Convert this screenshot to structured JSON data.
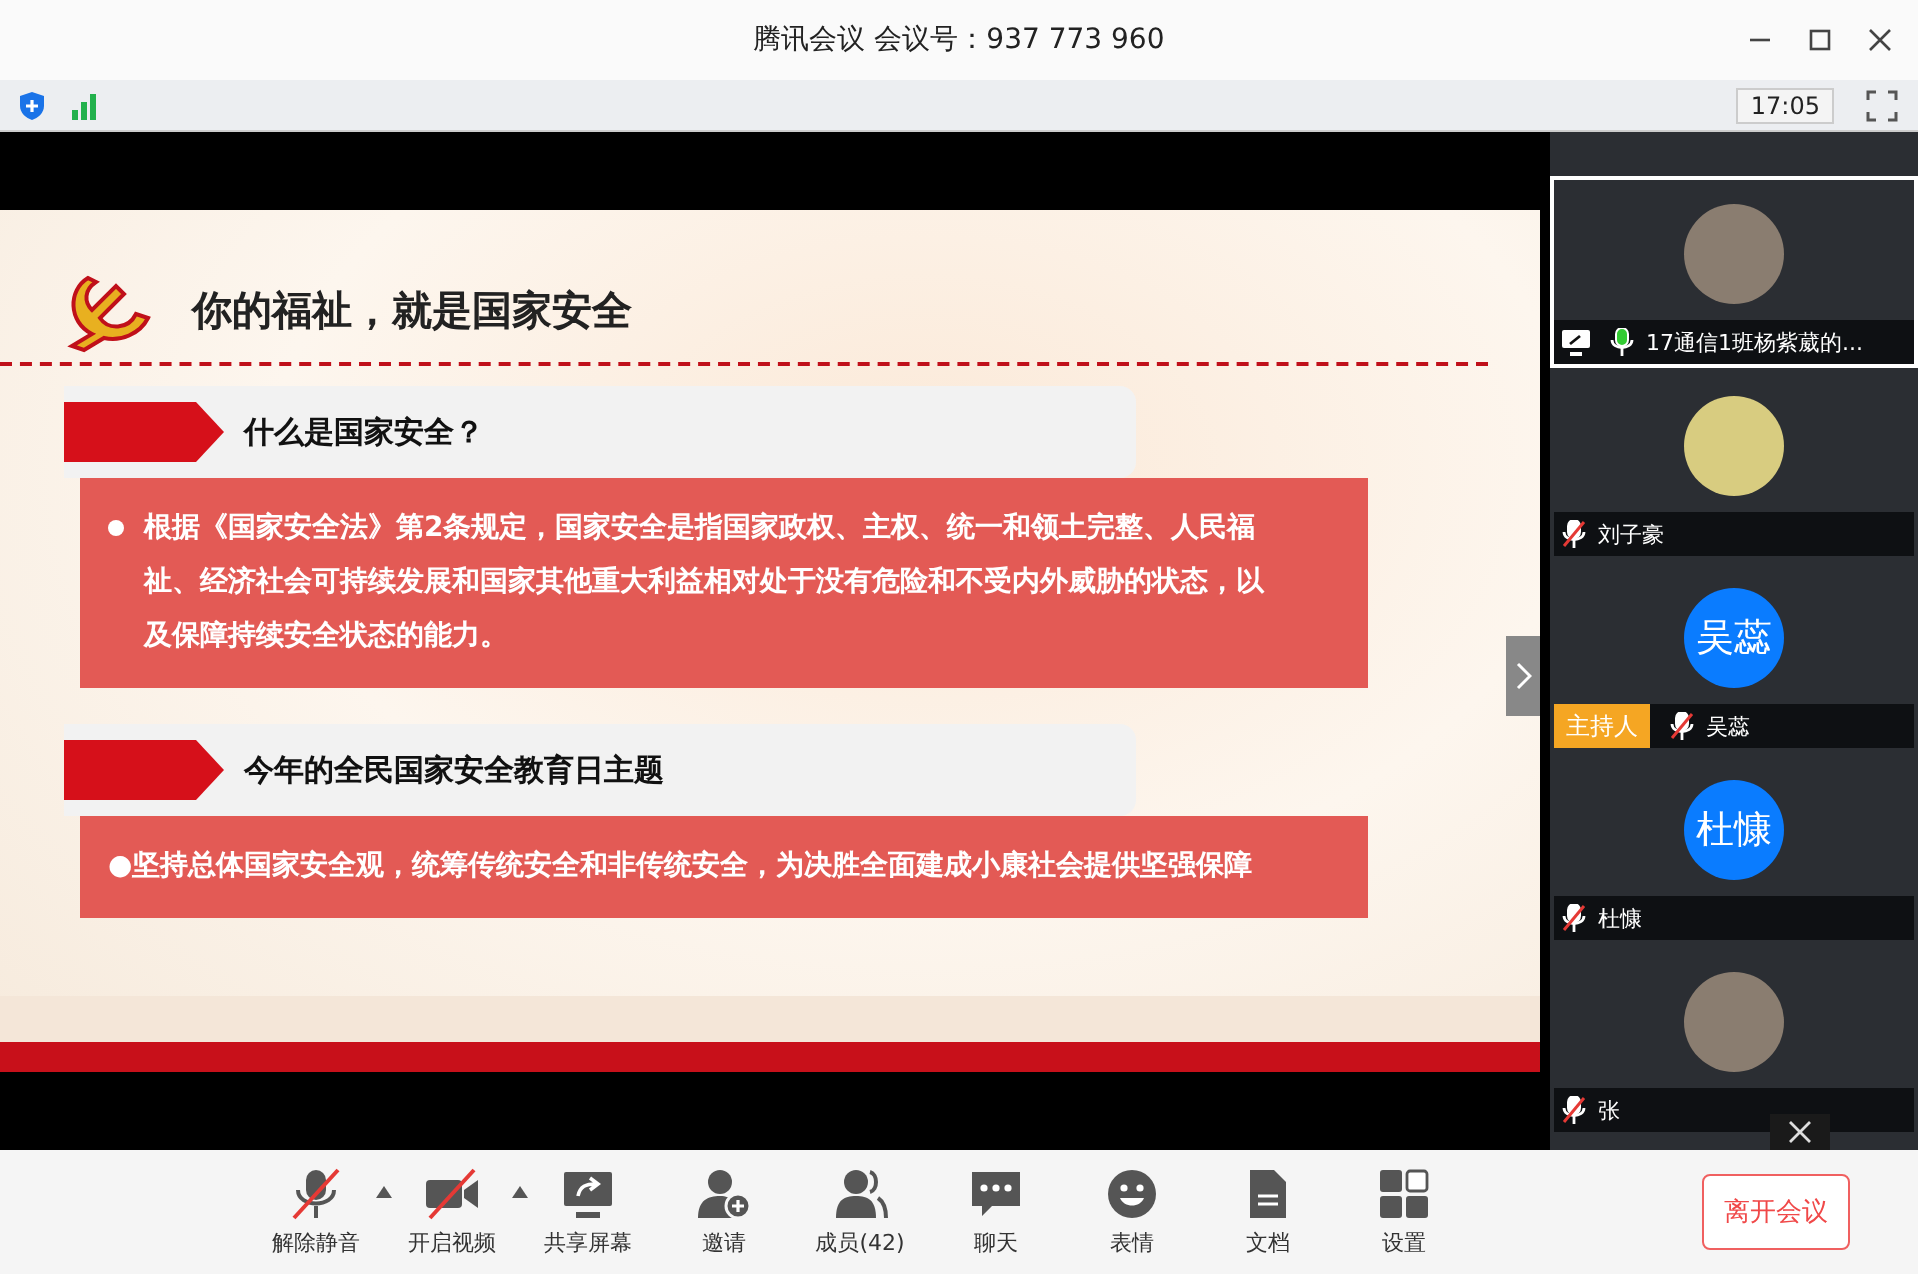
{
  "window": {
    "title": "腾讯会议 会议号：937 773 960"
  },
  "status_bar": {
    "time": "17:05"
  },
  "slide": {
    "title": "你的福祉，就是国家安全",
    "sections": [
      {
        "heading": "什么是国家安全？",
        "text": "根据《国家安全法》第2条规定，国家安全是指国家政权、主权、统一和领土完整、人民福祉、经济社会可持续发展和国家其他重大利益相对处于没有危险和不受内外威胁的状态，以及保障持续安全状态的能力。",
        "bullet": true
      },
      {
        "heading": "今年的全民国家安全教育日主题",
        "text": "●坚持总体国家安全观，统筹传统安全和非传统安全，为决胜全面建成小康社会提供坚强保障",
        "bullet": false
      }
    ]
  },
  "participants": [
    {
      "name": "17通信1班杨紫葳的...",
      "kind": "photo",
      "selected": true,
      "muted": false,
      "sharing": true
    },
    {
      "name": "刘子豪",
      "kind": "cartoon",
      "selected": false,
      "muted": true,
      "sharing": false
    },
    {
      "name": "吴蕊",
      "kind": "initials",
      "avatar_text": "吴蕊",
      "badge": "主持人",
      "selected": false,
      "muted": true,
      "sharing": false
    },
    {
      "name": "杜慷",
      "kind": "initials",
      "avatar_text": "杜慷",
      "selected": false,
      "muted": true,
      "sharing": false
    },
    {
      "name": "张",
      "kind": "photo",
      "selected": false,
      "muted": true,
      "sharing": false
    }
  ],
  "controls": [
    {
      "kind": "mic",
      "label": "解除静音",
      "off": true,
      "menu": true
    },
    {
      "kind": "camera",
      "label": "开启视频",
      "off": true,
      "menu": true
    },
    {
      "kind": "share",
      "label": "共享屏幕",
      "off": false,
      "menu": false
    },
    {
      "kind": "invite",
      "label": "邀请",
      "off": false,
      "menu": false
    },
    {
      "kind": "members",
      "label": "成员(42)",
      "off": false,
      "menu": false
    },
    {
      "kind": "chat",
      "label": "聊天",
      "off": false,
      "menu": false
    },
    {
      "kind": "emoji",
      "label": "表情",
      "off": false,
      "menu": false
    },
    {
      "kind": "doc",
      "label": "文档",
      "off": false,
      "menu": false
    },
    {
      "kind": "settings",
      "label": "设置",
      "off": false,
      "menu": false
    }
  ],
  "leave_button": "离开会议"
}
